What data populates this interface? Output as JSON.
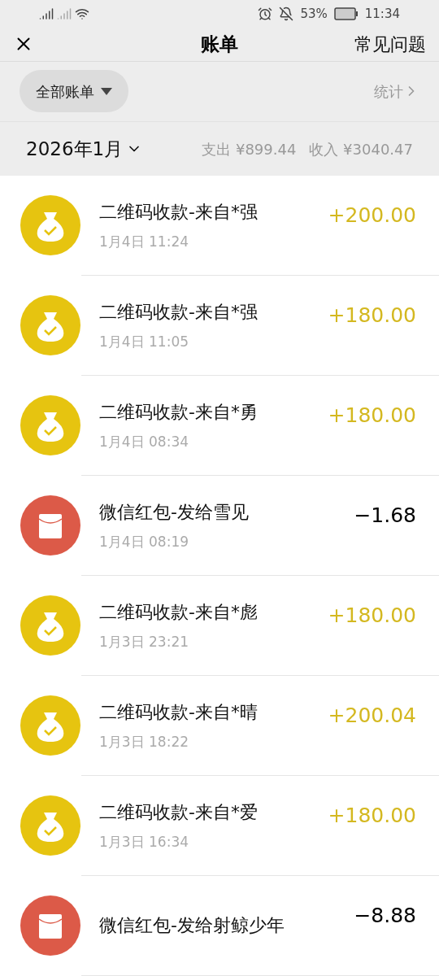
{
  "status_bar": {
    "battery": "53%",
    "time": "11:34"
  },
  "header": {
    "title": "账单",
    "help": "常见问题"
  },
  "filter": {
    "label": "全部账单",
    "stats": "统计"
  },
  "month": {
    "label": "2026年1月",
    "expense": "支出 ¥899.44",
    "income": "收入 ¥3040.47"
  },
  "transactions": [
    {
      "kind": "income",
      "title": "二维码收款-来自*强",
      "time": "1月4日 11:24",
      "amount": "+200.00"
    },
    {
      "kind": "income",
      "title": "二维码收款-来自*强",
      "time": "1月4日 11:05",
      "amount": "+180.00"
    },
    {
      "kind": "income",
      "title": "二维码收款-来自*勇",
      "time": "1月4日 08:34",
      "amount": "+180.00"
    },
    {
      "kind": "redpacket",
      "title": "微信红包-发给雪见",
      "time": "1月4日 08:19",
      "amount": "−1.68"
    },
    {
      "kind": "income",
      "title": "二维码收款-来自*彪",
      "time": "1月3日 23:21",
      "amount": "+180.00"
    },
    {
      "kind": "income",
      "title": "二维码收款-来自*晴",
      "time": "1月3日 18:22",
      "amount": "+200.04"
    },
    {
      "kind": "income",
      "title": "二维码收款-来自*爱",
      "time": "1月3日 16:34",
      "amount": "+180.00"
    },
    {
      "kind": "redpacket",
      "title": "微信红包-发给射鲸少年",
      "amount": "−8.88"
    }
  ]
}
